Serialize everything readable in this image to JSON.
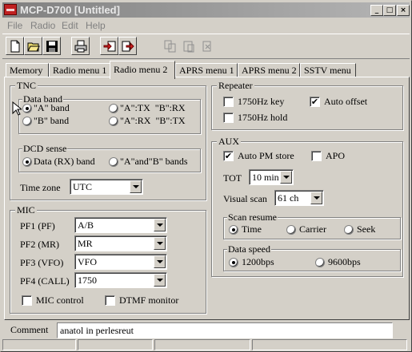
{
  "window": {
    "title": "MCP-D700 [Untitled]"
  },
  "titlebar_buttons": {
    "minimize": "_",
    "maximize": "□",
    "close": "×"
  },
  "menu": [
    "File",
    "Radio",
    "Edit",
    "Help"
  ],
  "toolbar": {
    "icons": [
      "new-icon",
      "open-icon",
      "save-icon",
      "print-icon",
      "read-from-radio-icon",
      "write-to-radio-icon",
      "copy-icon",
      "paste-icon",
      "delete-icon"
    ]
  },
  "tabs": [
    "Memory",
    "Radio menu 1",
    "Radio menu 2",
    "APRS menu 1",
    "APRS menu 2",
    "SSTV menu"
  ],
  "active_tab": "Radio menu 2",
  "tnc": {
    "title": "TNC",
    "data_band": {
      "title": "Data band",
      "options": [
        "\"A\" band",
        "\"B\" band",
        "\"A\":TX  \"B\":RX",
        "\"A\":RX  \"B\":TX"
      ],
      "selected": "\"A\" band"
    },
    "dcd_sense": {
      "title": "DCD sense",
      "options": [
        "Data (RX) band",
        "\"A\"and\"B\" bands"
      ],
      "selected": "Data (RX) band"
    },
    "time_zone": {
      "label": "Time zone",
      "value": "UTC"
    }
  },
  "mic": {
    "title": "MIC",
    "pf": [
      {
        "label": "PF1 (PF)",
        "value": "A/B"
      },
      {
        "label": "PF2 (MR)",
        "value": "MR"
      },
      {
        "label": "PF3 (VFO)",
        "value": "VFO"
      },
      {
        "label": "PF4 (CALL)",
        "value": "1750"
      }
    ],
    "mic_control": {
      "label": "MIC control",
      "checked": false
    },
    "dtmf_monitor": {
      "label": "DTMF monitor",
      "checked": false
    }
  },
  "repeater": {
    "title": "Repeater",
    "key_1750": {
      "label": "1750Hz key",
      "checked": false
    },
    "hold_1750": {
      "label": "1750Hz hold",
      "checked": false
    },
    "auto_offset": {
      "label": "Auto offset",
      "checked": true
    }
  },
  "aux": {
    "title": "AUX",
    "auto_pm_store": {
      "label": "Auto PM store",
      "checked": true
    },
    "apo": {
      "label": "APO",
      "checked": false
    },
    "tot": {
      "label": "TOT",
      "value": "10 min"
    },
    "visual_scan": {
      "label": "Visual scan",
      "value": "61 ch"
    },
    "scan_resume": {
      "title": "Scan resume",
      "options": [
        "Time",
        "Carrier",
        "Seek"
      ],
      "selected": "Time"
    },
    "data_speed": {
      "title": "Data speed",
      "options": [
        "1200bps",
        "9600bps"
      ],
      "selected": "1200bps"
    }
  },
  "comment": {
    "label": "Comment",
    "value": "anatol in perlesreut"
  },
  "check_mark": "✔"
}
